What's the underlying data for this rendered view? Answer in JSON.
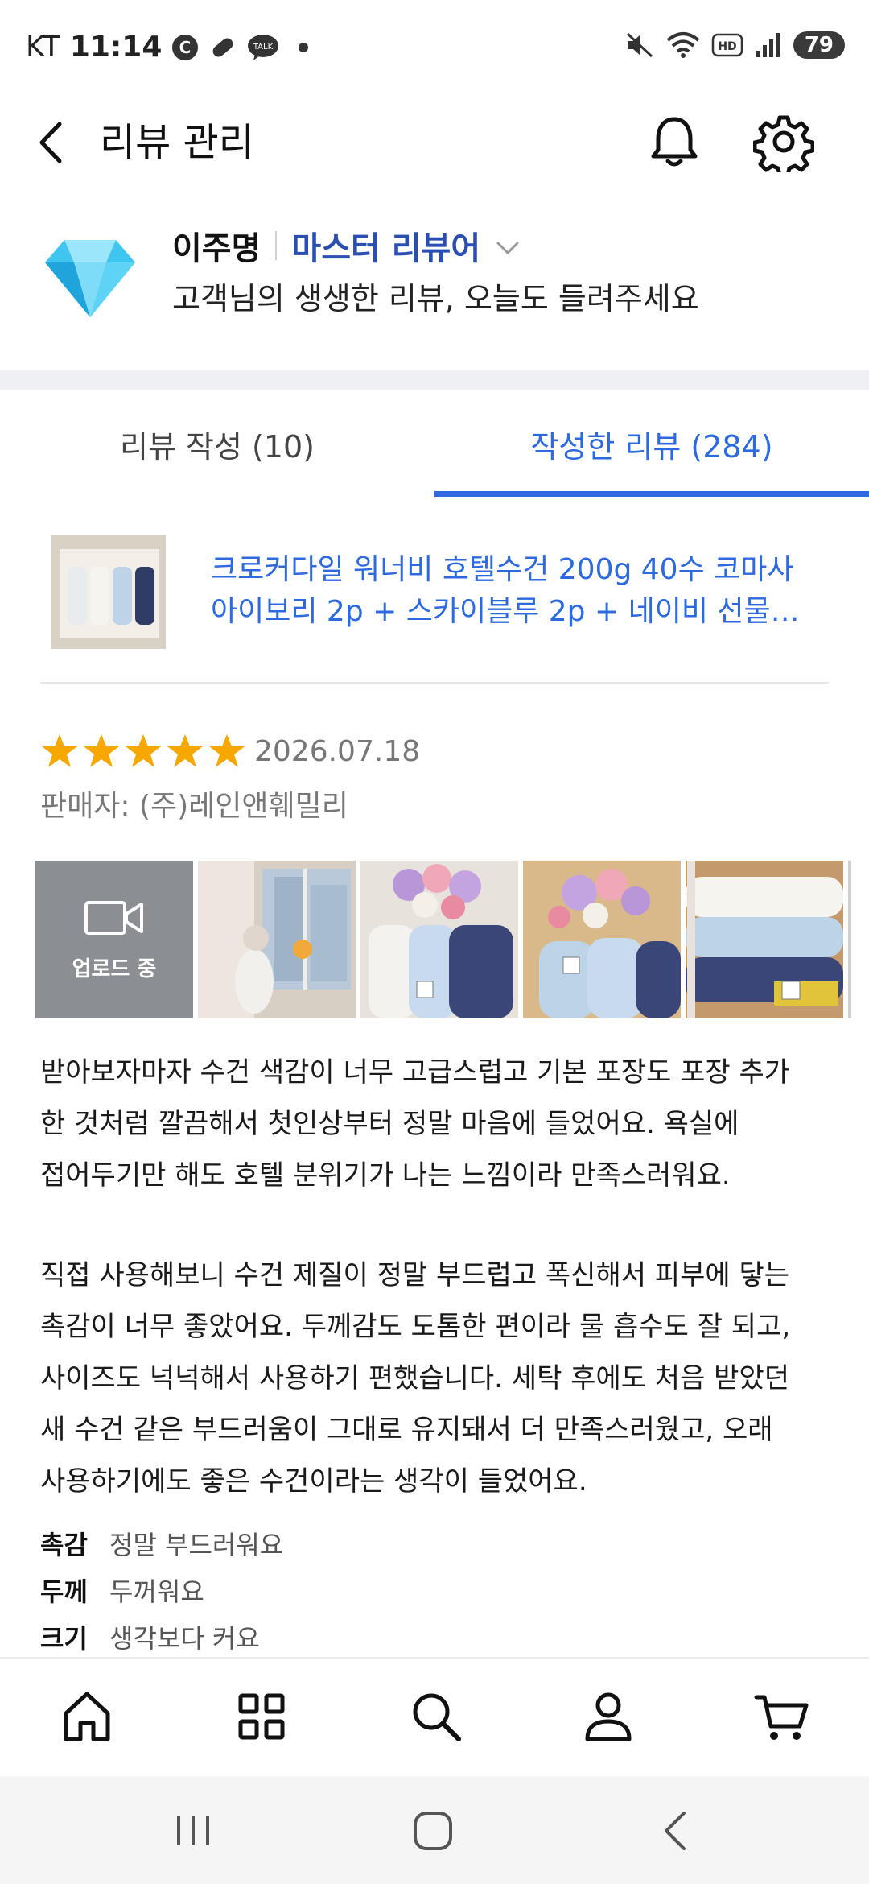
{
  "status": {
    "carrier": "KT",
    "time": "11:14",
    "battery": "79",
    "icons": [
      "c-icon",
      "pill-icon",
      "talk-icon",
      "mute-icon",
      "wifi-icon",
      "hd-icon",
      "signal-icon"
    ]
  },
  "header": {
    "title": "리뷰 관리",
    "icons": [
      "back-icon",
      "bell-icon",
      "gear-icon"
    ]
  },
  "profile": {
    "name": "이주명",
    "grade": "마스터 리뷰어",
    "subtitle": "고객님의 생생한 리뷰, 오늘도 들려주세요"
  },
  "tabs": [
    {
      "label": "리뷰 작성 (10)",
      "active": false
    },
    {
      "label": "작성한 리뷰 (284)",
      "active": true
    }
  ],
  "product": {
    "line1": "크로커다일 워너비 호텔수건 200g 40수 코마사",
    "line2": "아이보리 2p + 스카이블루 2p + 네이비 선물세..."
  },
  "review": {
    "rating": 5,
    "date": "2026.07.18",
    "seller": "판매자: (주)레인앤훼밀리",
    "upload_label": "업로드 중",
    "paragraph1": [
      "받아보자마자 수건 색감이 너무 고급스럽고 기본 포장도 포장 추가",
      "한 것처럼 깔끔해서 첫인상부터 정말 마음에 들었어요. 욕실에",
      "접어두기만 해도 호텔 분위기가 나는 느낌이라 만족스러워요."
    ],
    "paragraph2": [
      "직접 사용해보니 수건 제질이 정말 부드럽고 폭신해서 피부에 닿는",
      "촉감이 너무 좋았어요. 두께감도 도톰한 편이라 물 흡수도 잘 되고,",
      "사이즈도 넉넉해서 사용하기 편했습니다. 세탁 후에도 처음 받았던",
      "새 수건 같은 부드러움이 그대로 유지돼서 더 만족스러웠고, 오래",
      "사용하기에도 좋은 수건이라는 생각이 들었어요."
    ],
    "attributes": [
      {
        "key": "촉감",
        "value": "정말 부드러워요"
      },
      {
        "key": "두께",
        "value": "두꺼워요"
      },
      {
        "key": "크기",
        "value": "생각보다 커요"
      }
    ]
  },
  "bottom_nav": [
    "home-icon",
    "grid-icon",
    "search-icon",
    "profile-icon",
    "cart-icon"
  ],
  "colors": {
    "accent": "#2d6ae0",
    "grade": "#2a4fb0",
    "star": "#f6a800"
  }
}
